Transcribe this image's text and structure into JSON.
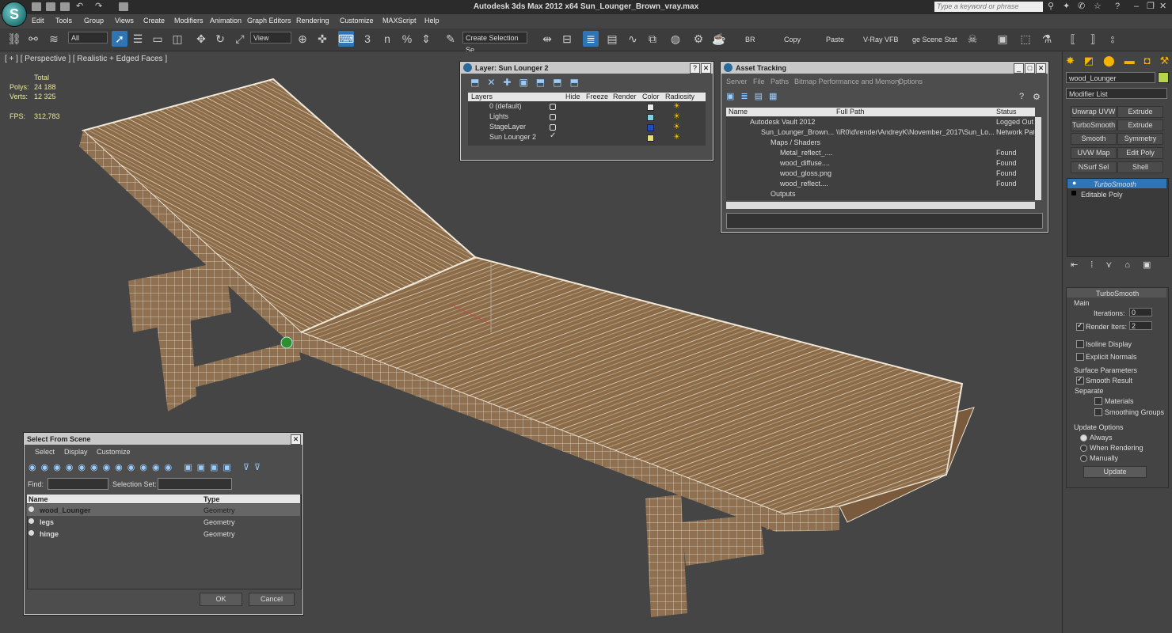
{
  "window": {
    "title": "Autodesk 3ds Max  2012 x64     Sun_Lounger_Brown_vray.max",
    "search_placeholder": "Type a keyword or phrase",
    "logo_glyph": "S"
  },
  "menu": [
    "Edit",
    "Tools",
    "Group",
    "Views",
    "Create",
    "Modifiers",
    "Animation",
    "Graph Editors",
    "Rendering",
    "Customize",
    "MAXScript",
    "Help"
  ],
  "toolbar": {
    "filter": "All",
    "ref_coord": "View",
    "selection_set": "Create Selection Se",
    "labels": [
      "BR",
      "Copy",
      "Paste",
      "V-Ray VFB",
      "ge Scene Stat"
    ],
    "snap_value": "3",
    "angle_snap": "n",
    "percent_snap": "%"
  },
  "viewport": {
    "label": "[ + ] [ Perspective ] [ Realistic + Edged Faces ]",
    "stats": {
      "header": "Total",
      "polys_label": "Polys:",
      "polys": "24 188",
      "verts_label": "Verts:",
      "verts": "12 325",
      "fps_label": "FPS:",
      "fps": "312,783"
    }
  },
  "layer_dialog": {
    "title": "Layer: Sun Lounger 2",
    "columns": [
      "Layers",
      "Hide",
      "Freeze",
      "Render",
      "Color",
      "Radiosity"
    ],
    "rows": [
      {
        "name": "0 (default)",
        "color": "#e8e8e8"
      },
      {
        "name": "Lights",
        "color": "#7fd0e0"
      },
      {
        "name": "StageLayer",
        "color": "#1f4fbf"
      },
      {
        "name": "Sun Lounger 2",
        "color": "#e6e07a"
      }
    ]
  },
  "asset_dialog": {
    "title": "Asset Tracking",
    "menu": [
      "Server",
      "File",
      "Paths",
      "Bitmap Performance and Memory",
      "Options"
    ],
    "columns": [
      "Name",
      "Full Path",
      "Status"
    ],
    "rows": [
      {
        "name": "Autodesk Vault 2012",
        "path": "",
        "status": "Logged Out (",
        "indent": 1
      },
      {
        "name": "Sun_Lounger_Brown....",
        "path": "\\\\R0\\d\\render\\AndreyK\\November_2017\\Sun_Lo...",
        "status": "Network Path",
        "indent": 2
      },
      {
        "name": "Maps / Shaders",
        "path": "",
        "status": "",
        "indent": 3
      },
      {
        "name": "Metal_reflect_....",
        "path": "",
        "status": "Found",
        "indent": 4
      },
      {
        "name": "wood_diffuse....",
        "path": "",
        "status": "Found",
        "indent": 4
      },
      {
        "name": "wood_gloss.png",
        "path": "",
        "status": "Found",
        "indent": 4
      },
      {
        "name": "wood_reflect....",
        "path": "",
        "status": "Found",
        "indent": 4
      },
      {
        "name": "Outputs",
        "path": "",
        "status": "",
        "indent": 3
      }
    ]
  },
  "select_dialog": {
    "title": "Select From Scene",
    "menu": [
      "Select",
      "Display",
      "Customize"
    ],
    "find_label": "Find:",
    "selset_label": "Selection Set:",
    "columns": [
      "Name",
      "Type"
    ],
    "rows": [
      {
        "name": "wood_Lounger",
        "type": "Geometry"
      },
      {
        "name": "legs",
        "type": "Geometry"
      },
      {
        "name": "hinge",
        "type": "Geometry"
      }
    ],
    "ok": "OK",
    "cancel": "Cancel"
  },
  "command_panel": {
    "object_name": "wood_Lounger",
    "object_color": "#b8d44a",
    "modifier_list": "Modifier List",
    "buttons": [
      "Unwrap UVW",
      "Extrude",
      "TurboSmooth",
      "Extrude",
      "Smooth",
      "Symmetry",
      "UVW Map",
      "Edit Poly",
      "NSurf Sel",
      "Shell"
    ],
    "stack": [
      "TurboSmooth",
      "Editable Poly"
    ],
    "rollout_title": "TurboSmooth",
    "main_group": "Main",
    "iterations_label": "Iterations:",
    "iterations": "0",
    "render_iters_label": "Render Iters:",
    "render_iters": "2",
    "isoline": "Isoline Display",
    "explicit": "Explicit Normals",
    "surface_group": "Surface Parameters",
    "smooth_result": "Smooth Result",
    "separate": "Separate",
    "materials": "Materials",
    "smoothing_groups": "Smoothing Groups",
    "update_group": "Update Options",
    "always": "Always",
    "when_rendering": "When Rendering",
    "manually": "Manually",
    "update_btn": "Update"
  },
  "colors": {
    "accent": "#2f74b5",
    "wood": "#8a6a48",
    "wire": "#e8e0d0"
  }
}
